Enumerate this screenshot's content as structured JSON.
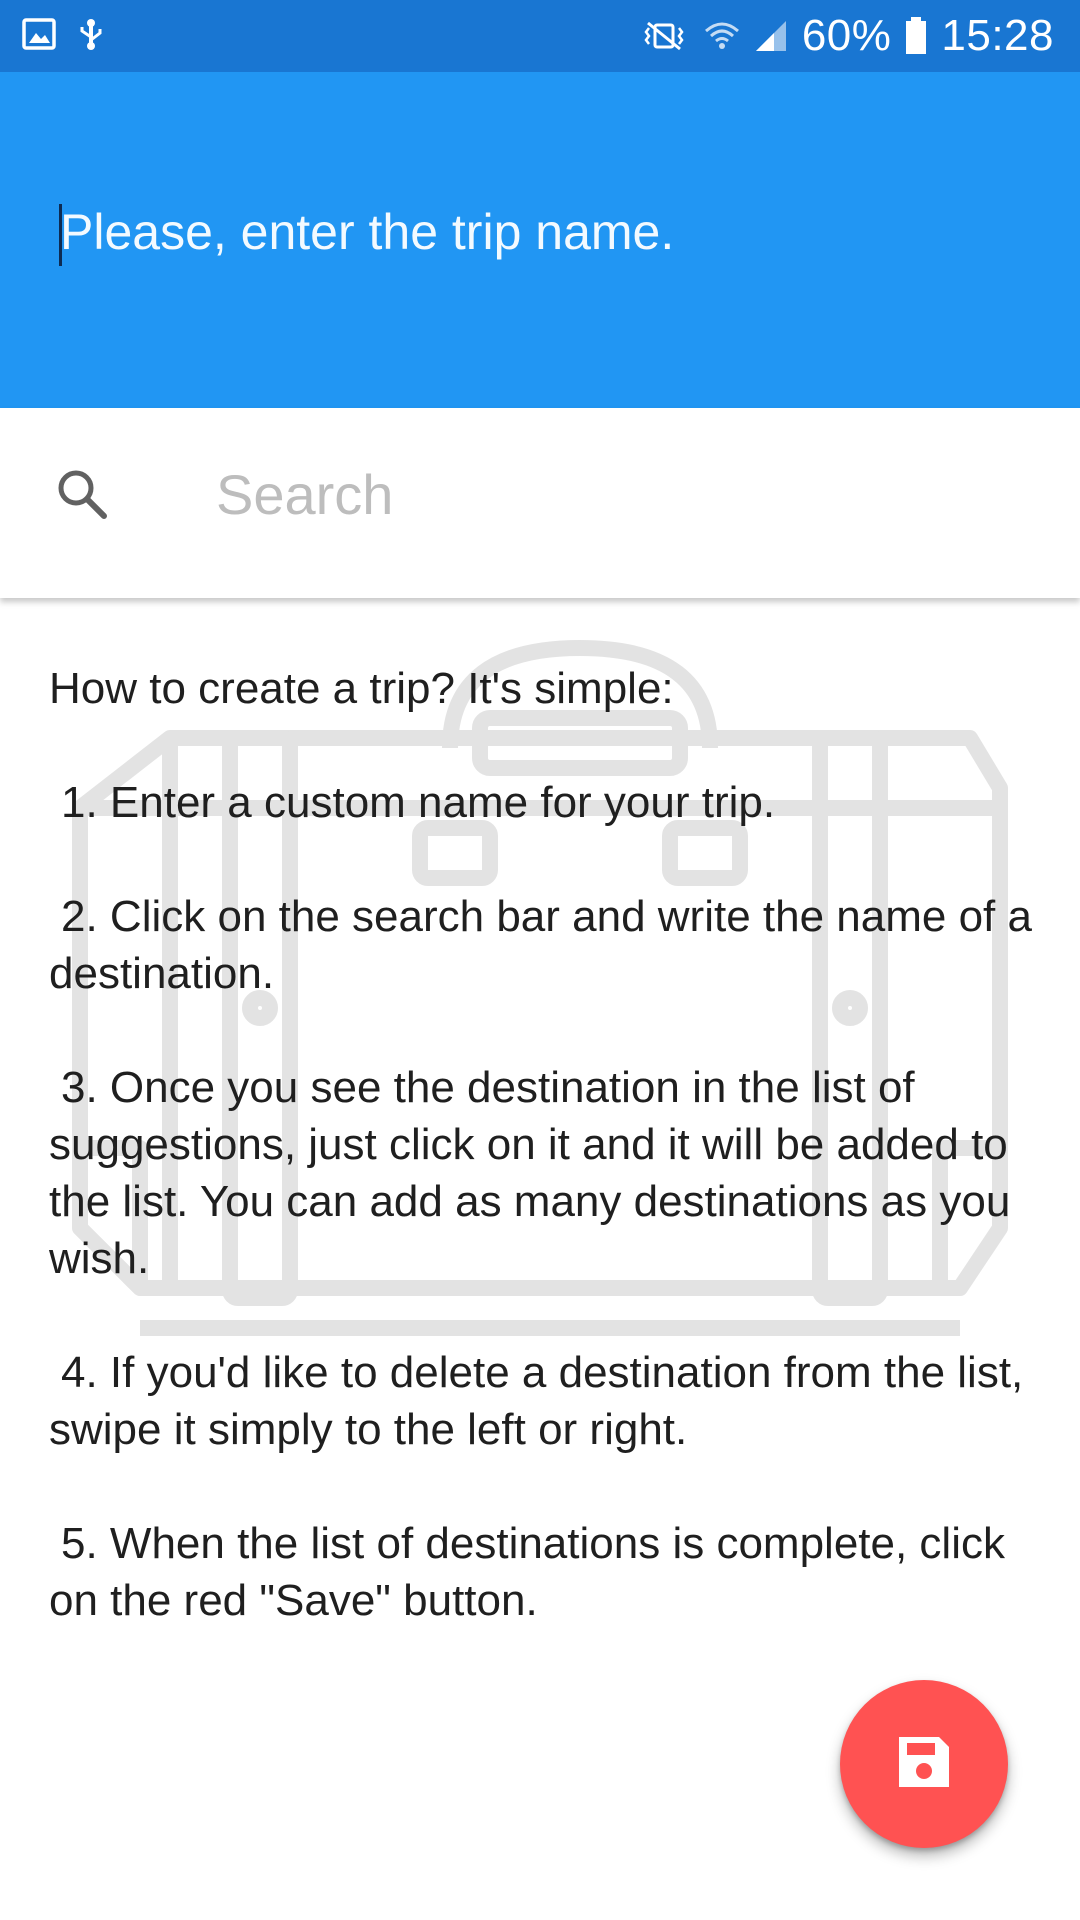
{
  "status_bar": {
    "left_icons": [
      "gallery-notification-icon",
      "usb-debug-icon"
    ],
    "right_icons": [
      "mute-vibrate-icon",
      "wifi-icon",
      "cell-signal-icon",
      "battery-icon"
    ],
    "battery_percent": "60%",
    "time": "15:28"
  },
  "header": {
    "trip_name_placeholder": "Please, enter the trip name.",
    "trip_name_value": ""
  },
  "search": {
    "icon": "search-icon",
    "placeholder": "Search",
    "value": ""
  },
  "instructions": {
    "intro": "How to create a trip? It's simple:",
    "steps": [
      "1. Enter a custom name for your trip.",
      "2. Click on the search bar and write the name of a destination.",
      "3. Once you see the destination in the list of suggestions, just click on it and it will be added to the list. You can add as many destinations as you wish.",
      "4. If you'd like to delete a destination from the list, swipe it simply to the left or right.",
      "5. When the list of destinations is complete, click on the red \"Save\" button."
    ]
  },
  "fab": {
    "icon": "save-icon",
    "color": "#ff5252"
  },
  "colors": {
    "status_bar": "#1976d2",
    "app_bar": "#2196f3",
    "accent": "#ff5252"
  }
}
